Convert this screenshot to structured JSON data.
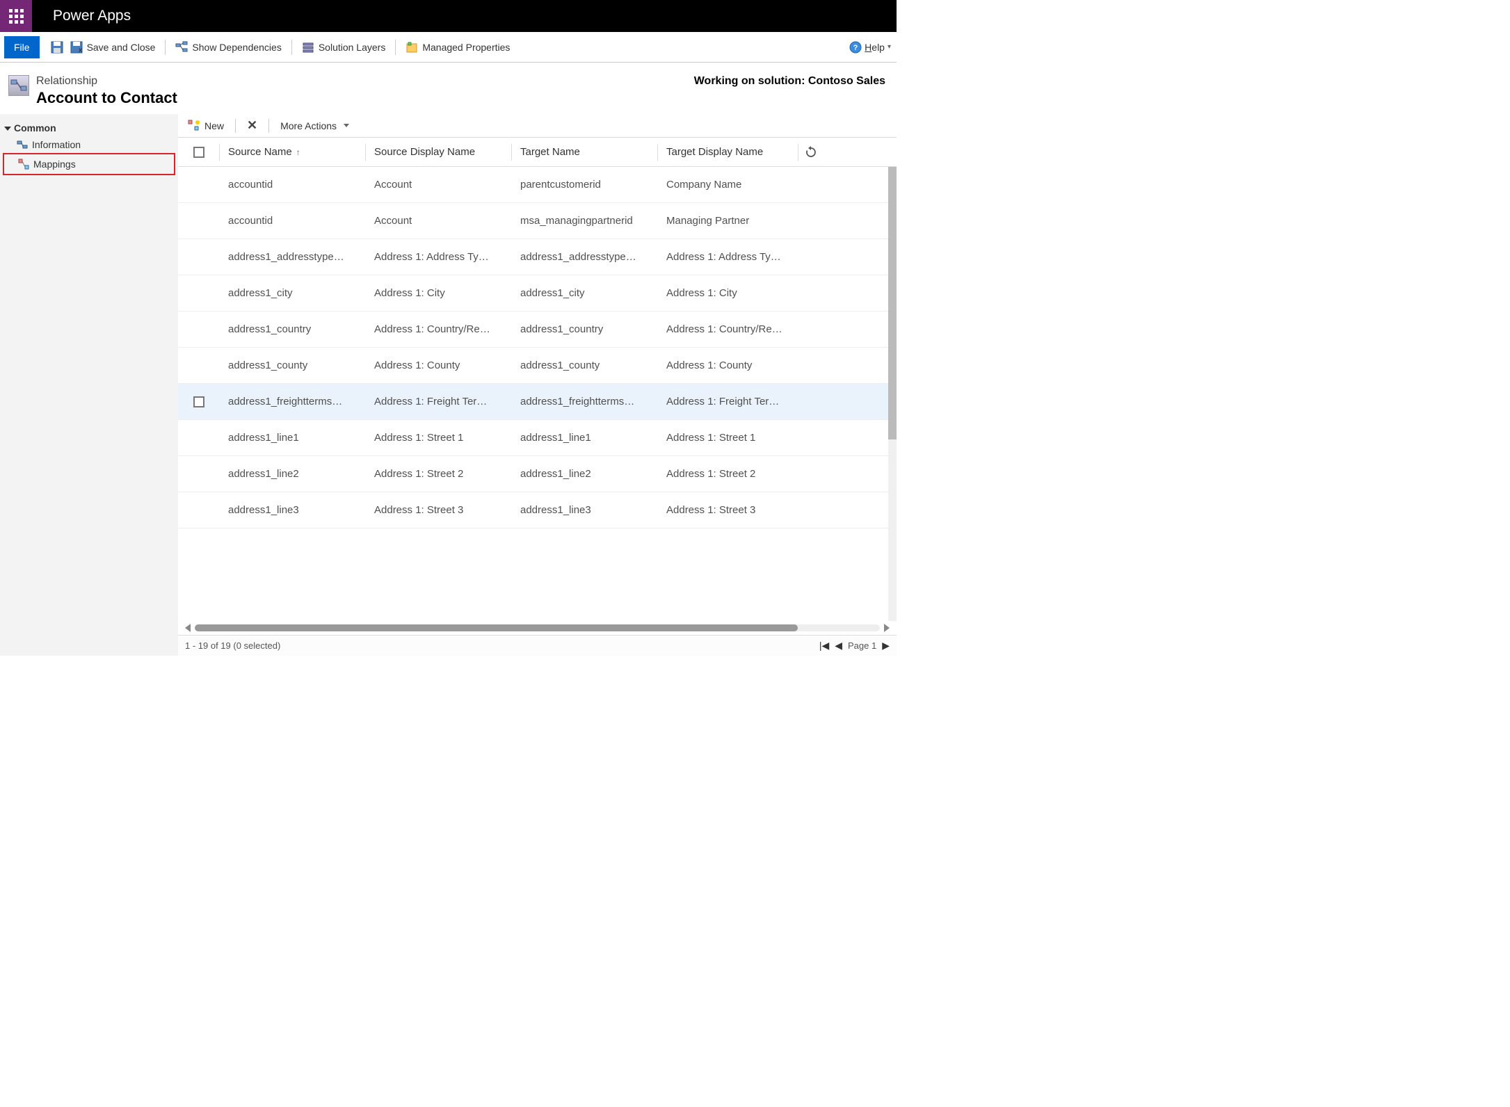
{
  "topbar": {
    "app_title": "Power Apps"
  },
  "commandbar": {
    "file": "File",
    "save_close": "Save and Close",
    "show_dependencies": "Show Dependencies",
    "solution_layers": "Solution Layers",
    "managed_properties": "Managed Properties",
    "help": "Help"
  },
  "header": {
    "relationship_lbl": "Relationship",
    "entity_title": "Account to Contact",
    "working_solution": "Working on solution: Contoso Sales"
  },
  "leftnav": {
    "common": "Common",
    "information": "Information",
    "mappings": "Mappings"
  },
  "grid_toolbar": {
    "new": "New",
    "more_actions": "More Actions"
  },
  "columns": {
    "source_name": "Source Name",
    "source_display": "Source Display Name",
    "target_name": "Target Name",
    "target_display": "Target Display Name"
  },
  "rows": [
    {
      "sn": "accountid",
      "sd": "Account",
      "tn": "parentcustomerid",
      "td": "Company Name"
    },
    {
      "sn": "accountid",
      "sd": "Account",
      "tn": "msa_managingpartnerid",
      "td": "Managing Partner"
    },
    {
      "sn": "address1_addresstype…",
      "sd": "Address 1: Address Ty…",
      "tn": "address1_addresstype…",
      "td": "Address 1: Address Ty…"
    },
    {
      "sn": "address1_city",
      "sd": "Address 1: City",
      "tn": "address1_city",
      "td": "Address 1: City"
    },
    {
      "sn": "address1_country",
      "sd": "Address 1: Country/Re…",
      "tn": "address1_country",
      "td": "Address 1: Country/Re…"
    },
    {
      "sn": "address1_county",
      "sd": "Address 1: County",
      "tn": "address1_county",
      "td": "Address 1: County"
    },
    {
      "sn": "address1_freightterms…",
      "sd": "Address 1: Freight Ter…",
      "tn": "address1_freightterms…",
      "td": "Address 1: Freight Ter…"
    },
    {
      "sn": "address1_line1",
      "sd": "Address 1: Street 1",
      "tn": "address1_line1",
      "td": "Address 1: Street 1"
    },
    {
      "sn": "address1_line2",
      "sd": "Address 1: Street 2",
      "tn": "address1_line2",
      "td": "Address 1: Street 2"
    },
    {
      "sn": "address1_line3",
      "sd": "Address 1: Street 3",
      "tn": "address1_line3",
      "td": "Address 1: Street 3"
    }
  ],
  "status": {
    "record_count": "1 - 19 of 19 (0 selected)",
    "page_label": "Page 1"
  }
}
